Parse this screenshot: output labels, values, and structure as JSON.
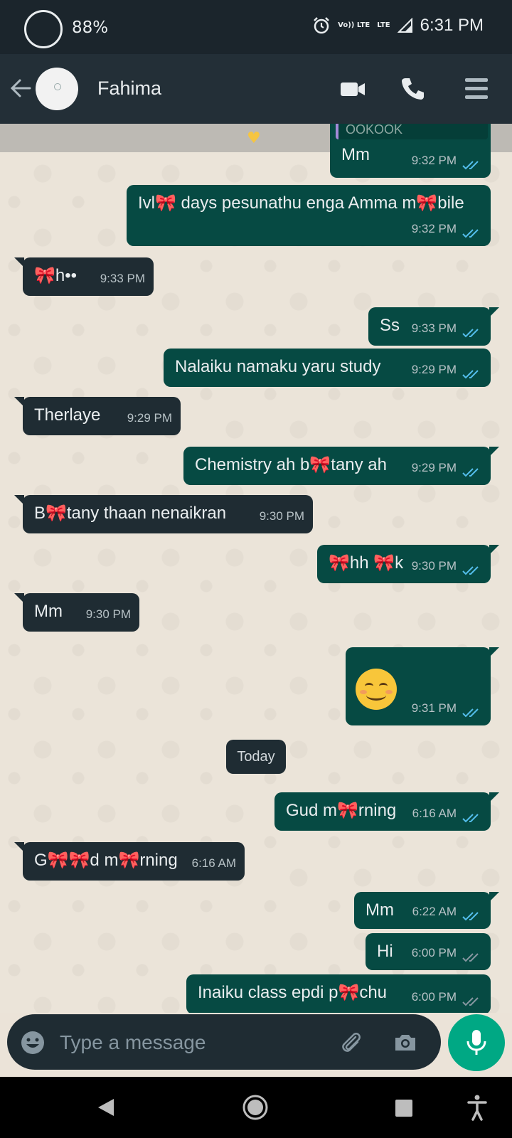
{
  "status": {
    "battery": "88%",
    "time": "6:31 PM",
    "network_top": "Vo)) LTE",
    "network_label": "LTE"
  },
  "header": {
    "contact_name": "Fahima"
  },
  "chat": {
    "clipped_quote": "OOKOOK",
    "messages": [
      {
        "dir": "out",
        "text": "Mm",
        "time": "9:32 PM",
        "ticks": "read"
      },
      {
        "dir": "out",
        "text": "Ivl🎀 days pesunathu enga Amma m🎀bile",
        "time": "9:32 PM",
        "ticks": "read"
      },
      {
        "dir": "in",
        "text": "🎀h••",
        "time": "9:33 PM"
      },
      {
        "dir": "out",
        "text": "Ss",
        "time": "9:33 PM",
        "ticks": "read"
      },
      {
        "dir": "out",
        "text": "Nalaiku namaku yaru study",
        "time": "9:29 PM",
        "ticks": "read"
      },
      {
        "dir": "in",
        "text": "Therlaye",
        "time": "9:29 PM"
      },
      {
        "dir": "out",
        "text": "Chemistry ah b🎀tany ah",
        "time": "9:29 PM",
        "ticks": "read"
      },
      {
        "dir": "in",
        "text": "B🎀tany thaan nenaikran",
        "time": "9:30 PM"
      },
      {
        "dir": "out",
        "text": "🎀hh 🎀k",
        "time": "9:30 PM",
        "ticks": "read"
      },
      {
        "dir": "in",
        "text": "Mm",
        "time": "9:30 PM"
      },
      {
        "dir": "out",
        "text": "😊",
        "time": "9:31 PM",
        "ticks": "read",
        "emoji": true
      },
      {
        "dir": "out",
        "text": "Gud m🎀rning",
        "time": "6:16 AM",
        "ticks": "read"
      },
      {
        "dir": "in",
        "text": "G🎀🎀d m🎀rning",
        "time": "6:16 AM"
      },
      {
        "dir": "out",
        "text": "Mm",
        "time": "6:22 AM",
        "ticks": "read"
      },
      {
        "dir": "out",
        "text": "Hi",
        "time": "6:00 PM",
        "ticks": "delivered"
      },
      {
        "dir": "out",
        "text": "Inaiku class epdi p🎀chu",
        "time": "6:00 PM",
        "ticks": "delivered"
      }
    ],
    "date_chip": "Today"
  },
  "composer": {
    "placeholder": "Type a message"
  },
  "colors": {
    "outgoing": "#064a43",
    "incoming": "#1f2c33",
    "read_tick": "#53bdeb",
    "delivered_tick": "#8696a0",
    "accent": "#00a884"
  }
}
